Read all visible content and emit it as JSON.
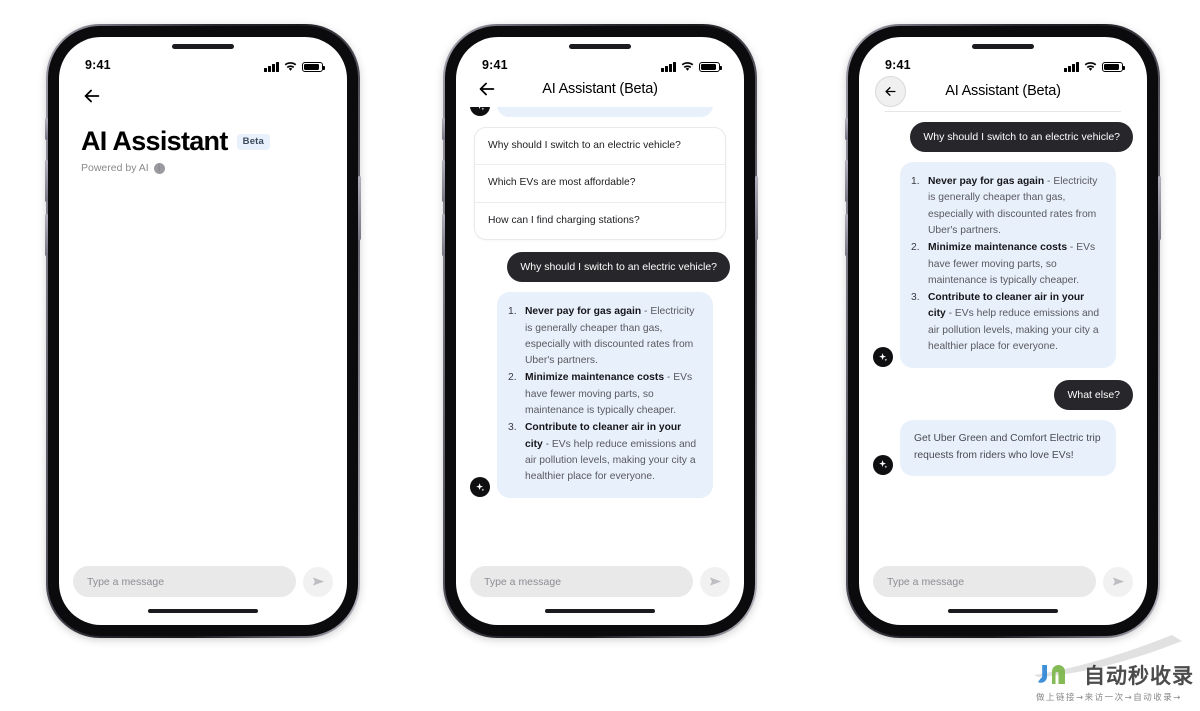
{
  "status_bar": {
    "time": "9:41",
    "signal_icon": "cellular-bars-icon",
    "wifi_icon": "wifi-icon",
    "battery_icon": "battery-icon"
  },
  "phones": [
    {
      "id": "phone-empty-state",
      "header": {
        "type": "large",
        "back_icon": "back-arrow-icon",
        "title": "AI Assistant",
        "badge": "Beta",
        "subtitle": "Powered by AI",
        "info_icon": "info-icon",
        "info_glyph": "i"
      },
      "messages": [],
      "composer": {
        "placeholder": "Type a message",
        "value": "",
        "send_icon": "send-icon"
      }
    },
    {
      "id": "phone-suggestions",
      "header": {
        "type": "center",
        "back_icon": "back-arrow-icon",
        "title": "AI Assistant (Beta)"
      },
      "scrolled_partial_bubble": true,
      "suggestions": [
        "Why should I switch to an electric vehicle?",
        "Which EVs are most affordable?",
        "How can I find charging stations?"
      ],
      "messages": [
        {
          "role": "user",
          "text": "Why should I switch to an electric vehicle?"
        },
        {
          "role": "ai",
          "avatar_icon": "sparkle-icon",
          "list": [
            {
              "bold": "Never pay for gas again",
              "rest": " - Electricity is generally cheaper than gas, especially with discounted rates from Uber's partners."
            },
            {
              "bold": "Minimize maintenance costs",
              "rest": " - EVs have fewer moving parts, so maintenance is typically cheaper."
            },
            {
              "bold": "Contribute to cleaner air in your city",
              "rest": " - EVs help reduce emissions and air pollution levels, making your city a healthier place for everyone."
            }
          ]
        }
      ],
      "composer": {
        "placeholder": "Type a message",
        "value": "",
        "send_icon": "send-icon"
      }
    },
    {
      "id": "phone-conversation",
      "header": {
        "type": "center-circle-back",
        "back_icon": "back-arrow-icon",
        "title": "AI Assistant (Beta)"
      },
      "messages": [
        {
          "role": "user",
          "text": "Why should I switch to an electric vehicle?"
        },
        {
          "role": "ai",
          "avatar_icon": "sparkle-icon",
          "list": [
            {
              "bold": "Never pay for gas again",
              "rest": " - Electricity is generally cheaper than gas, especially with discounted rates from Uber's partners."
            },
            {
              "bold": "Minimize maintenance costs",
              "rest": " - EVs have fewer moving parts, so maintenance is typically cheaper."
            },
            {
              "bold": "Contribute to cleaner air in your city",
              "rest": " - EVs help reduce emissions and air pollution levels, making your city a healthier place for everyone."
            }
          ]
        },
        {
          "role": "user",
          "text": "What else?"
        },
        {
          "role": "ai",
          "avatar_icon": "sparkle-icon",
          "text": "Get Uber Green and Comfort Electric trip requests from riders who love EVs!"
        }
      ],
      "composer": {
        "placeholder": "Type a message",
        "value": "",
        "send_icon": "send-icon"
      }
    }
  ],
  "watermark": {
    "title": "自动秒收录",
    "subtitle": "做上链接→来访一次→自动收录→",
    "logo_icon": "jn-logo-icon"
  },
  "colors": {
    "user_bubble": "#27272b",
    "ai_bubble": "#e8f0fb",
    "badge_bg": "#e7f0fb",
    "input_bg": "#e9e9ea",
    "phone_body": "#0b0b0d"
  }
}
